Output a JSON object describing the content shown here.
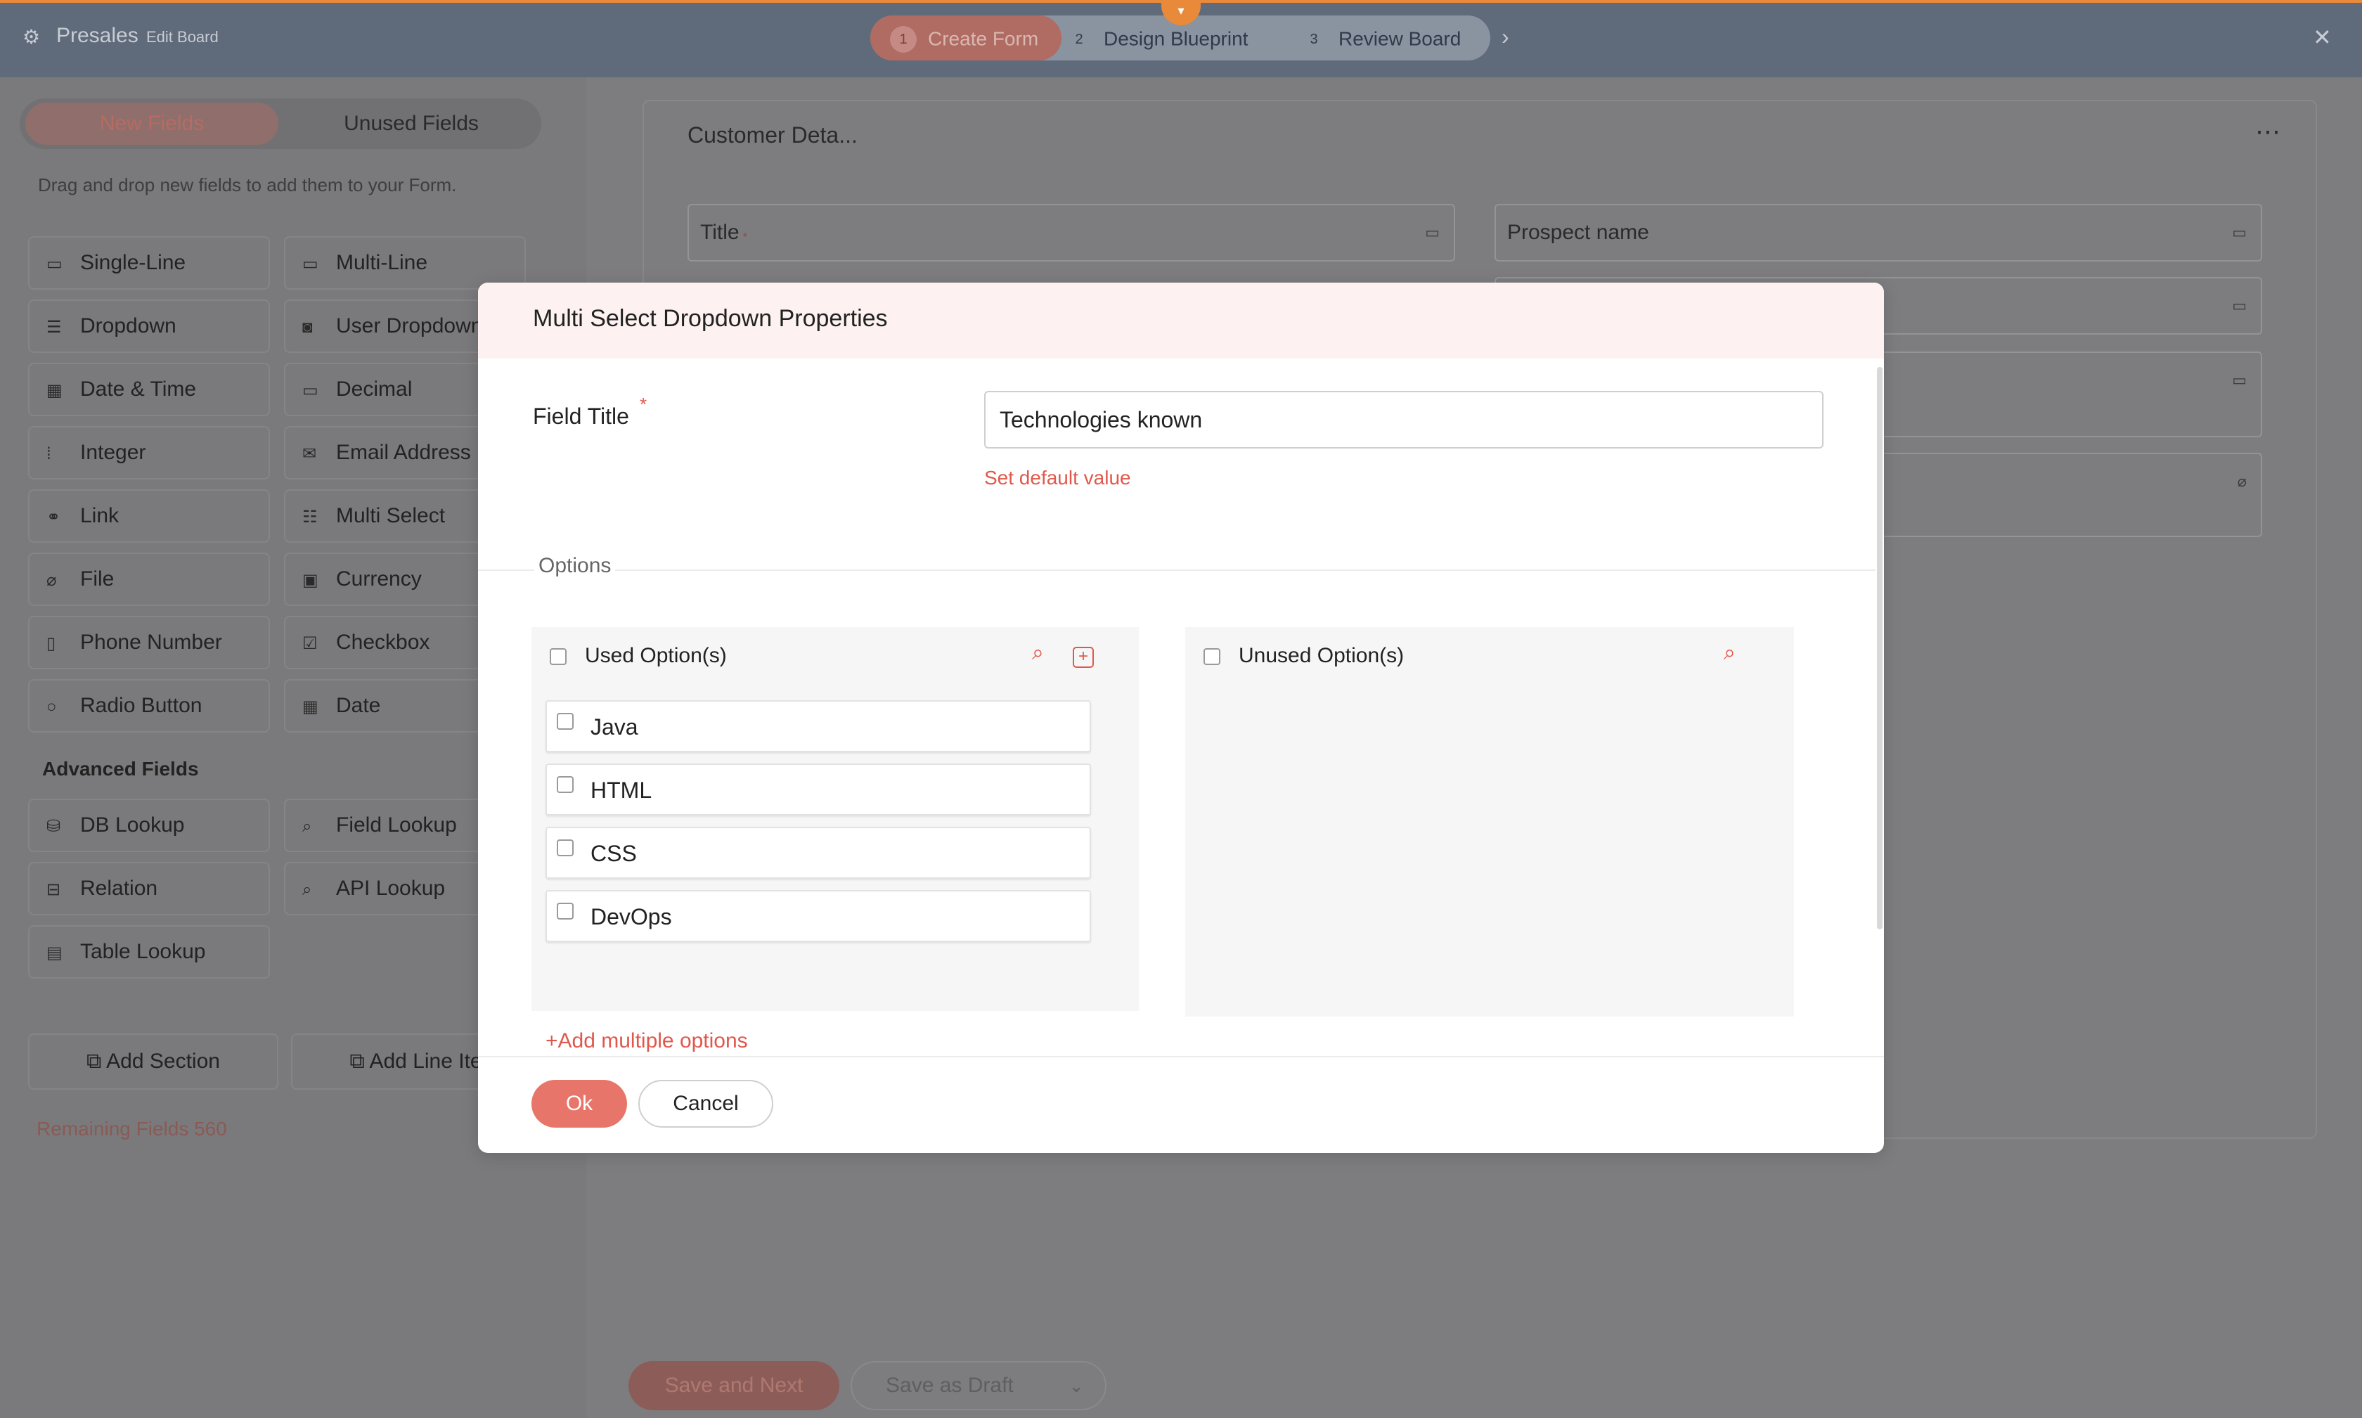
{
  "header": {
    "app_title": "Presales",
    "app_subtitle": "Edit Board",
    "steps": [
      {
        "num": "1",
        "label": "Create Form"
      },
      {
        "num": "2",
        "label": "Design Blueprint"
      },
      {
        "num": "3",
        "label": "Review Board"
      }
    ]
  },
  "left_panel": {
    "tabs": {
      "new": "New Fields",
      "unused": "Unused Fields"
    },
    "hint": "Drag and drop new fields to add them to your Form.",
    "fields": [
      "Single-Line",
      "Multi-Line",
      "Dropdown",
      "User Dropdown",
      "Date & Time",
      "Decimal",
      "Integer",
      "Email Address",
      "Link",
      "Multi Select",
      "File",
      "Currency",
      "Phone Number",
      "Checkbox",
      "Radio Button",
      "Date"
    ],
    "advanced_label": "Advanced Fields",
    "advanced_fields": [
      "DB Lookup",
      "Field Lookup",
      "Relation",
      "API Lookup",
      "Table Lookup"
    ],
    "add_section": "Add Section",
    "add_line_item": "Add Line Item",
    "remaining": "Remaining Fields 560"
  },
  "canvas": {
    "section_title": "Customer Deta...",
    "fields": [
      "Title",
      "Prospect name"
    ],
    "save_next": "Save and Next",
    "save_draft": "Save as Draft"
  },
  "modal": {
    "title": "Multi Select Dropdown Properties",
    "field_title_label": "Field Title",
    "required_mark": "*",
    "field_title_value": "Technologies known",
    "set_default": "Set default value",
    "options_label": "Options",
    "used_label": "Used Option(s)",
    "unused_label": "Unused Option(s)",
    "used_options": [
      "Java",
      "HTML",
      "CSS",
      "DevOps"
    ],
    "add_multiple": "+Add multiple options",
    "ok": "Ok",
    "cancel": "Cancel"
  },
  "colors": {
    "accent": "#e8756a",
    "accent_text": "#e0584c",
    "topbar": "#5f6a7a",
    "top_border": "#e98a3a",
    "overlay": "#7a7a7c"
  }
}
